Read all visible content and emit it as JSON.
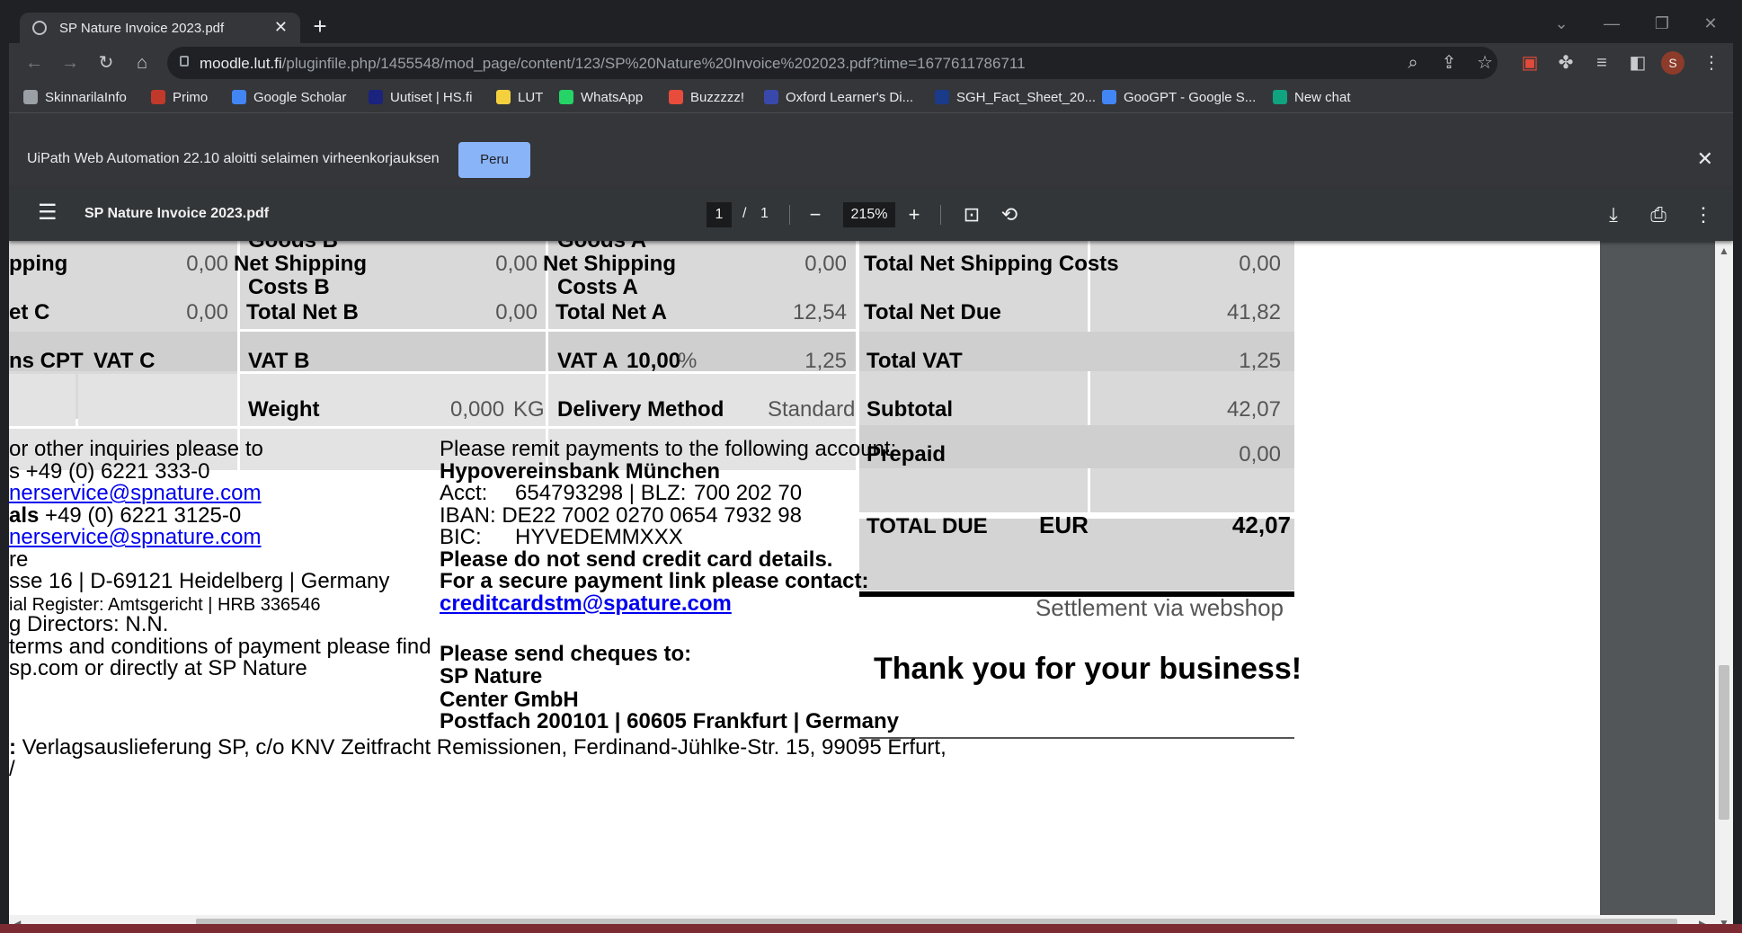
{
  "browser": {
    "tab_title": "SP Nature Invoice 2023.pdf",
    "tab_close": "✕",
    "new_tab": "+",
    "url_host": "moodle.lut.fi",
    "url_path": "/pluginfile.php/1455548/mod_page/content/123/SP%20Nature%20Invoice%202023.pdf?time=1677611786711",
    "profile_initial": "S"
  },
  "bookmarks": [
    {
      "label": "SkinnarilaInfo",
      "color": "#9aa0a6"
    },
    {
      "label": "Primo",
      "color": "#c0392b"
    },
    {
      "label": "Google Scholar",
      "color": "#4285f4"
    },
    {
      "label": "Uutiset | HS.fi",
      "color": "#1a237e"
    },
    {
      "label": "LUT",
      "color": "#f4d03f"
    },
    {
      "label": "WhatsApp",
      "color": "#25d366"
    },
    {
      "label": "Buzzzzz!",
      "color": "#e74c3c"
    },
    {
      "label": "Oxford Learner's Di...",
      "color": "#3949ab"
    },
    {
      "label": "SGH_Fact_Sheet_20...",
      "color": "#1a3a8a"
    },
    {
      "label": "GooGPT - Google S...",
      "color": "#4285f4"
    },
    {
      "label": "New chat",
      "color": "#10a37f"
    }
  ],
  "infobar": {
    "message": "UiPath Web Automation 22.10 aloitti selaimen virheenkorjauksen",
    "cancel_label": "Peru"
  },
  "pdf_toolbar": {
    "doc_title": "SP Nature Invoice 2023.pdf",
    "page_current": "1",
    "page_sep": "/",
    "page_total": "1",
    "zoom": "215%"
  },
  "invoice": {
    "col_c": {
      "net_shipping_label": "pping",
      "net_shipping_value": "0,00",
      "total_net_label": "et C",
      "total_net_value": "0,00",
      "cpt_label": "ns CPT",
      "vat_label": "VAT C"
    },
    "col_b": {
      "goods_label": "Goods B",
      "net_shipping_label": "Net Shipping",
      "net_shipping_label2": "Costs B",
      "net_shipping_value": "0,00",
      "total_net_label": "Total  Net B",
      "total_net_value": "0,00",
      "vat_label": "VAT B",
      "weight_label": "Weight",
      "weight_value": "0,000",
      "weight_unit": "KG"
    },
    "col_a": {
      "goods_label": "Goods A",
      "net_shipping_label": "Net Shipping",
      "net_shipping_label2": "Costs A",
      "net_shipping_value": "0,00",
      "total_net_label": "Total  Net A",
      "total_net_value": "12,54",
      "vat_label": "VAT A",
      "vat_rate": "10,00",
      "vat_pct": "%",
      "vat_value": "1,25",
      "delivery_label": "Delivery Method",
      "delivery_value": "Standard"
    },
    "totals": {
      "shipping_label": "Total Net  Shipping Costs",
      "shipping_value": "0,00",
      "net_due_label": "Total  Net Due",
      "net_due_value": "41,82",
      "vat_label": "Total VAT",
      "vat_value": "1,25",
      "subtotal_label": "Subtotal",
      "subtotal_value": "42,07",
      "prepaid_label": "Prepaid",
      "prepaid_value": "0,00",
      "due_label": "TOTAL DUE",
      "due_currency": "EUR",
      "due_value": "42,07",
      "settlement": "Settlement via webshop",
      "thanks": "Thank you for your business!"
    },
    "contact": {
      "line1": "or other inquiries please to",
      "phone1_prefix": "s",
      "phone1": "+49 (0) 6221 333-0",
      "email1": "nerservice@spnature.com",
      "phone2_prefix": "als",
      "phone2": "+49 (0) 6221 3125-0",
      "email2": "nerservice@spnature.com",
      "line6": "re",
      "address": "sse 16 | D-69121 Heidelberg | Germany",
      "register": "ial Register: Amtsgericht | HRB 336546",
      "directors": "g Directors: N.N.",
      "terms1": "terms and conditions of payment please find",
      "terms2": "sp.com or directly at SP Nature"
    },
    "payment": {
      "intro": "Please remit payments to the following account:",
      "bank": "Hypovereinsbank München",
      "acct_label": "Acct:",
      "acct_value": "654793298 | BLZ:",
      "blz_value": "700 202 70",
      "iban": "IBAN: DE22 7002 0270 0654 7932 98",
      "bic_label": "BIC:",
      "bic_value": "HYVEDEMMXXX",
      "no_cc": "Please do not send credit card details.",
      "secure": "For a secure payment link please contact:",
      "email": "creditcardstm@spature.com",
      "cheques": "Please send cheques to:",
      "payee1": "SP Nature",
      "payee2": "Center GmbH",
      "postfach": "Postfach 200101 | 60605 Frankfurt | Germany"
    },
    "footer": {
      "prefix": ":",
      "text": "Verlagsauslieferung SP, c/o KNV Zeitfracht Remissionen, Ferdinand-Jühlke-Str. 15, 99095 Erfurt,",
      "tail": "/"
    }
  }
}
